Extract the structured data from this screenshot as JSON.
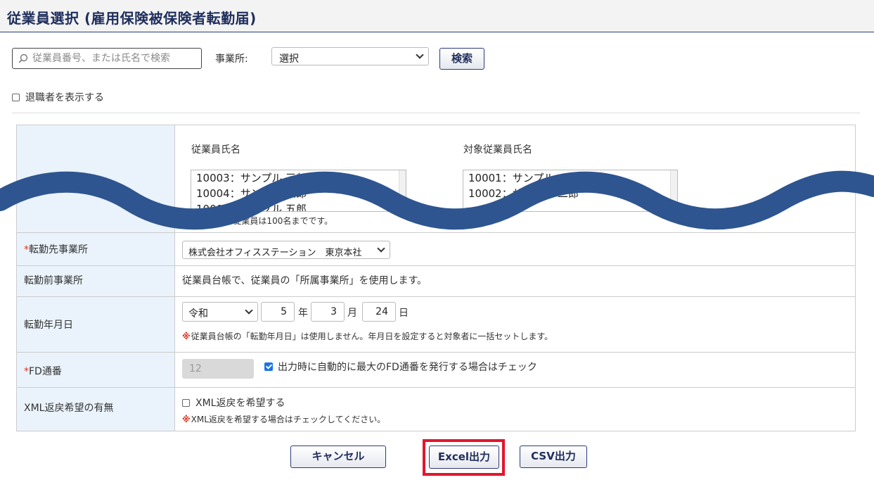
{
  "page": {
    "title": "従業員選択 (雇用保険被保険者転勤届)"
  },
  "search": {
    "placeholder": "従業員番号、または氏名で検索",
    "office_label": "事業所:",
    "office_value": "選択",
    "search_button": "検索"
  },
  "filter": {
    "show_retired_label": "退職者を表示する"
  },
  "employees": {
    "available_header": "従業員氏名",
    "target_header": "対象従業員氏名",
    "available": [
      "10003：サンプル 三郎",
      "10004：サンプル 四郎",
      "10005：サンプル 五郎"
    ],
    "target": [
      "10001：サンプル 一郎",
      "10002：サンプル 二郎"
    ],
    "note_mark": "※",
    "note": "選択できる従業員は100名までです。"
  },
  "form": {
    "required_mark": "*",
    "dest_office": {
      "label": "転勤先事業所",
      "value": "株式会社オフィスステーション　東京本社"
    },
    "prev_office": {
      "label": "転勤前事業所",
      "text": "従業員台帳で、従業員の「所属事業所」を使用します。"
    },
    "transfer_date": {
      "label": "転勤年月日",
      "era": "令和",
      "year": "5",
      "year_unit": "年",
      "month": "3",
      "month_unit": "月",
      "day": "24",
      "day_unit": "日",
      "note_mark": "※",
      "note": "従業員台帳の「転勤年月日」は使用しません。年月日を設定すると対象者に一括セットします。"
    },
    "fd_number": {
      "label": "FD通番",
      "value": "12",
      "auto_label": "出力時に自動的に最大のFD通番を発行する場合はチェック",
      "auto_checked": true
    },
    "xml_return": {
      "label": "XML返戻希望の有無",
      "checkbox_label": "XML返戻を希望する",
      "note_mark": "※",
      "note": "XML返戻を希望する場合はチェックしてください。"
    }
  },
  "actions": {
    "cancel": "キャンセル",
    "excel": "Excel出力",
    "csv": "CSV出力"
  },
  "colors": {
    "accent": "#1f2e5c",
    "highlight": "#e2162d",
    "required": "#e0301e",
    "label_bg": "#eaf3fb",
    "wave": "#2e5590"
  }
}
